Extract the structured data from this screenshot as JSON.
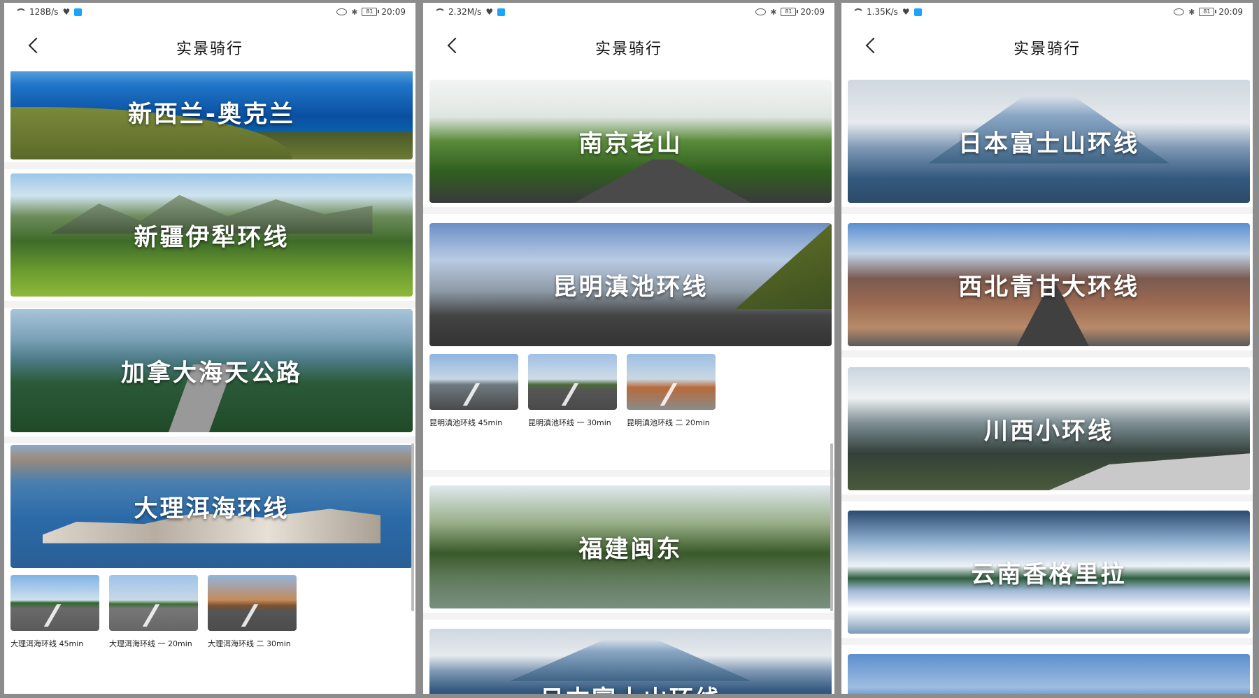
{
  "screens": [
    {
      "status": {
        "speed": "128B/s",
        "time": "20:09",
        "battery": "81"
      },
      "title": "实景骑行",
      "routes": [
        {
          "title": "新西兰-奥克兰",
          "scene": "ocean"
        },
        {
          "title": "新疆伊犁环线",
          "scene": "meadow"
        },
        {
          "title": "加拿大海天公路",
          "scene": "coast"
        },
        {
          "title": "大理洱海环线",
          "scene": "lake"
        }
      ],
      "thumbnails": [
        {
          "label": "大理洱海环线 45min"
        },
        {
          "label": "大理洱海环线 一 20min"
        },
        {
          "label": "大理洱海环线 二 30min"
        }
      ]
    },
    {
      "status": {
        "speed": "2.32M/s",
        "time": "20:09",
        "battery": "81"
      },
      "title": "实景骑行",
      "routes": [
        {
          "title": "南京老山",
          "scene": "forest-road"
        },
        {
          "title": "昆明滇池环线",
          "scene": "bridge"
        },
        {
          "title": "福建闽东",
          "scene": "pagoda"
        },
        {
          "title": "日本富士山环线",
          "scene": "fuji"
        }
      ],
      "thumbnails": [
        {
          "label": "昆明滇池环线 45min"
        },
        {
          "label": "昆明滇池环线 一 30min"
        },
        {
          "label": "昆明滇池环线 二 20min"
        }
      ]
    },
    {
      "status": {
        "speed": "1.35K/s",
        "time": "20:09",
        "battery": "81"
      },
      "title": "实景骑行",
      "routes": [
        {
          "title": "日本富士山环线",
          "scene": "fuji"
        },
        {
          "title": "西北青甘大环线",
          "scene": "gansu"
        },
        {
          "title": "川西小环线",
          "scene": "snow"
        },
        {
          "title": "云南香格里拉",
          "scene": "shangri"
        },
        {
          "title": "",
          "scene": "sky"
        }
      ]
    }
  ]
}
